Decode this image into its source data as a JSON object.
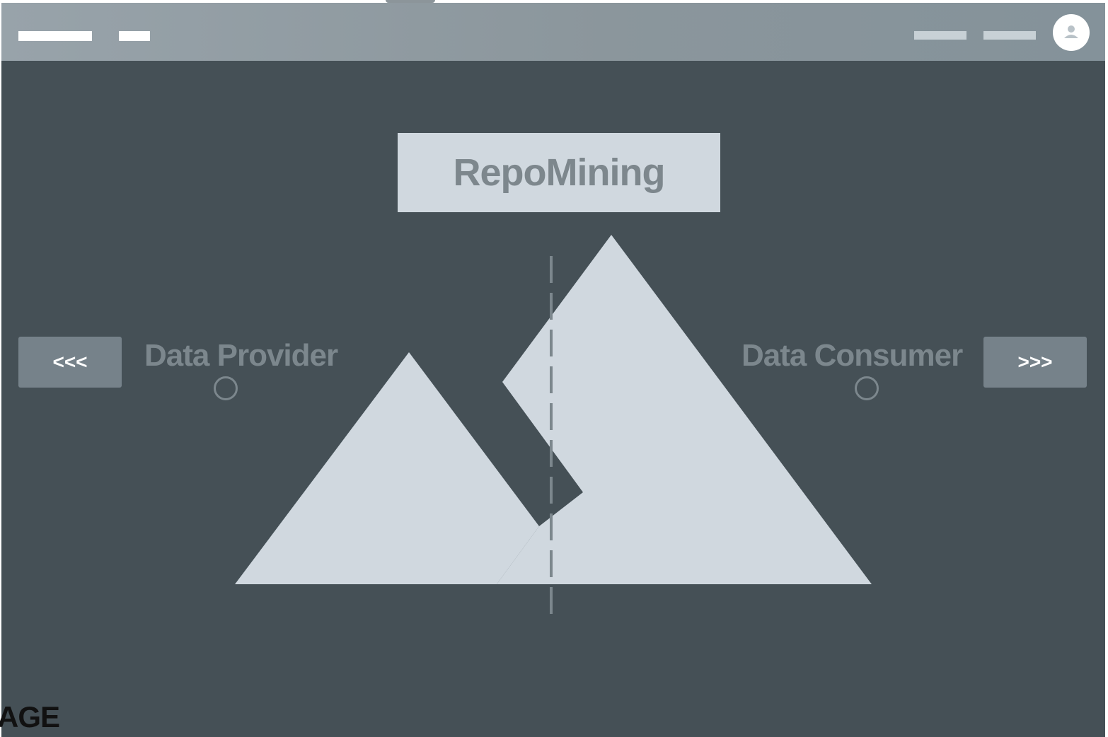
{
  "title": "RepoMining",
  "left_nav": {
    "label": "<<<",
    "side_label": "Data Provider"
  },
  "right_nav": {
    "label": ">>>",
    "side_label": "Data Consumer"
  },
  "caption": "AGE",
  "icons": {
    "avatar": "user-avatar-icon",
    "illustration": "image-placeholder-icon"
  },
  "colors": {
    "window_bg": "#455056",
    "topbar": "#8b969c",
    "panel": "#d0d8df",
    "button": "#76828a",
    "muted_text": "#7c878d"
  }
}
